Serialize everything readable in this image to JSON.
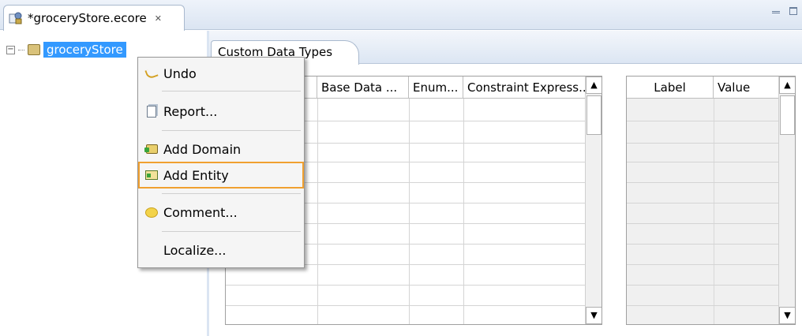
{
  "editor_tab": {
    "title": "*groceryStore.ecore",
    "close_glyph": "✕"
  },
  "tree": {
    "root_label": "groceryStore",
    "expander": "−"
  },
  "subtab": {
    "label": "Custom Data Types"
  },
  "left_table": {
    "columns": [
      ".",
      "Base Data ...",
      "Enum...",
      "Constraint Express..."
    ]
  },
  "right_table": {
    "columns": [
      "Label",
      "Value"
    ]
  },
  "scroll": {
    "up": "▲",
    "down": "▼"
  },
  "context_menu": {
    "items": [
      {
        "label": "Undo",
        "icon": "undo-icon"
      },
      {
        "label": "Report...",
        "icon": "report-icon"
      },
      {
        "label": "Add Domain",
        "icon": "add-domain-icon"
      },
      {
        "label": "Add Entity",
        "icon": "add-entity-icon",
        "highlighted": true
      },
      {
        "label": "Comment...",
        "icon": "comment-icon"
      },
      {
        "label": "Localize...",
        "icon": null
      }
    ]
  },
  "colors": {
    "selection": "#3399ff",
    "highlight_border": "#f0a030"
  }
}
